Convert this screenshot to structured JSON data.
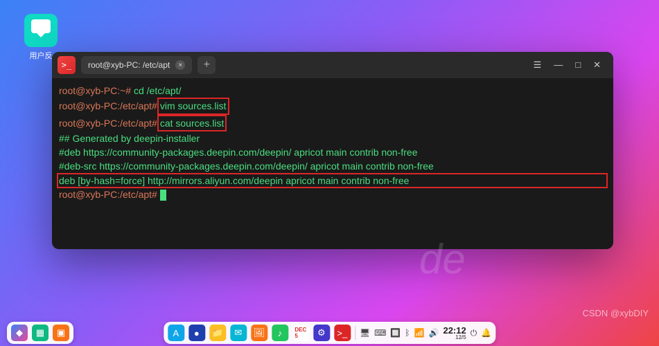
{
  "desktop": {
    "icon_label": "用户反"
  },
  "window": {
    "tab_title": "root@xyb-PC: /etc/apt",
    "lines": {
      "l1_prompt": "root@xyb-PC:~#",
      "l1_cmd": " cd /etc/apt/",
      "l2_prompt": "root@xyb-PC:/etc/apt#",
      "l2_cmd": " vim sources.list",
      "l3_prompt": "root@xyb-PC:/etc/apt#",
      "l3_cmd": " cat sources.list",
      "l4": "## Generated by deepin-installer",
      "l5": "#deb https://community-packages.deepin.com/deepin/ apricot main contrib non-free",
      "l6": "#deb-src https://community-packages.deepin.com/deepin/ apricot main contrib non-free",
      "l7": "deb [by-hash=force] http://mirrors.aliyun.com/deepin apricot main contrib non-free",
      "l8_prompt": "root@xyb-PC:/etc/apt#"
    }
  },
  "wm": "de",
  "watermark": "CSDN @xybDIY",
  "clock": {
    "time": "22:12",
    "date": "12/5"
  }
}
